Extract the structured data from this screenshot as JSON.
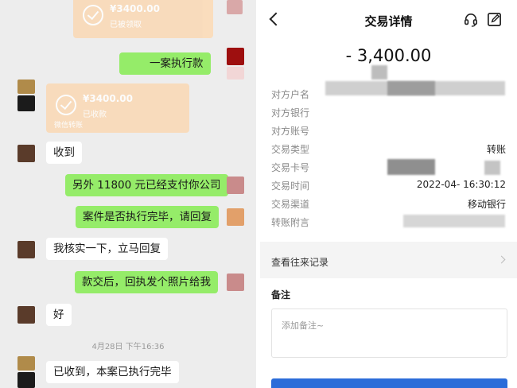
{
  "chat": {
    "transfer_top": {
      "amount": "¥3400.00",
      "status": "已被领取"
    },
    "transfer_mid": {
      "amount": "¥3400.00",
      "status": "已收款",
      "footer": "微信转账"
    },
    "messages": [
      {
        "side": "me",
        "text": "一案执行款"
      },
      {
        "side": "other",
        "text": "收到"
      },
      {
        "side": "me",
        "text": "另外 11800 元已经支付你公司"
      },
      {
        "side": "me",
        "text": "案件是否执行完毕，请回复"
      },
      {
        "side": "other",
        "text": "我核实一下，立马回复"
      },
      {
        "side": "me",
        "text": "款交后，回执发个照片给我"
      },
      {
        "side": "other",
        "text": "好"
      },
      {
        "side": "other",
        "text": "已收到，本案已执行完毕"
      }
    ],
    "timestamp": "4月28日 下午16:36"
  },
  "detail": {
    "title": "交易详情",
    "amount": "- 3,400.00",
    "rows": [
      {
        "label": "对方户名",
        "value": ""
      },
      {
        "label": "对方银行",
        "value": ""
      },
      {
        "label": "对方账号",
        "value": ""
      },
      {
        "label": "交易类型",
        "value": "转账"
      },
      {
        "label": "交易卡号",
        "value": ""
      },
      {
        "label": "交易时间",
        "value": "2022-04-  16:30:12"
      },
      {
        "label": "交易渠道",
        "value": "移动银行"
      },
      {
        "label": "转账附言",
        "value": ""
      }
    ],
    "history_label": "查看往来记录",
    "notes_title": "备注",
    "notes_placeholder": "添加备注~",
    "colors": {
      "accent": "#2b6cd9",
      "chat_me": "#95ec69",
      "transfer": "#fbd9b4"
    }
  }
}
